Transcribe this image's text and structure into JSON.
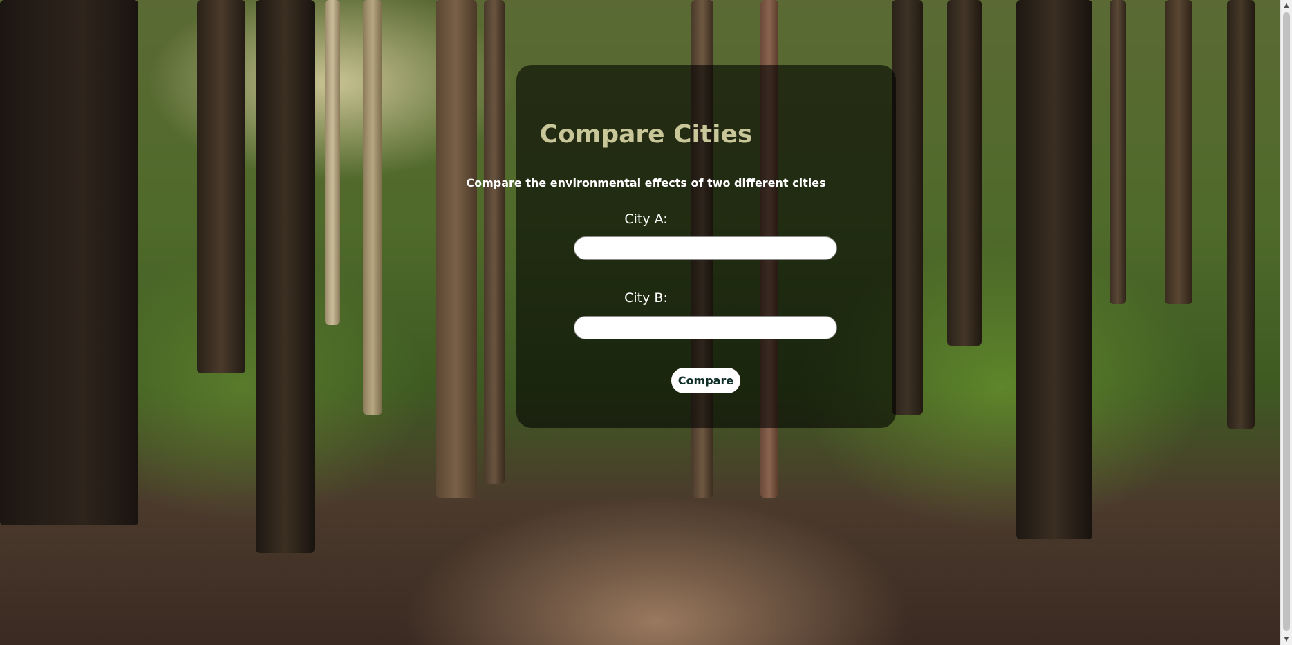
{
  "page": {
    "title": "Compare Cities",
    "subtitle": "Compare the environmental effects of two different cities"
  },
  "form": {
    "city_a": {
      "label": "City A:",
      "value": "",
      "placeholder": ""
    },
    "city_b": {
      "label": "City B:",
      "value": "",
      "placeholder": ""
    },
    "submit_label": "Compare"
  },
  "scrollbar": {
    "up_icon": "▲",
    "down_icon": "▼"
  },
  "colors": {
    "title": "#c9c79a",
    "card_overlay": "rgba(0,0,0,0.58)",
    "button_text": "#12302a"
  }
}
